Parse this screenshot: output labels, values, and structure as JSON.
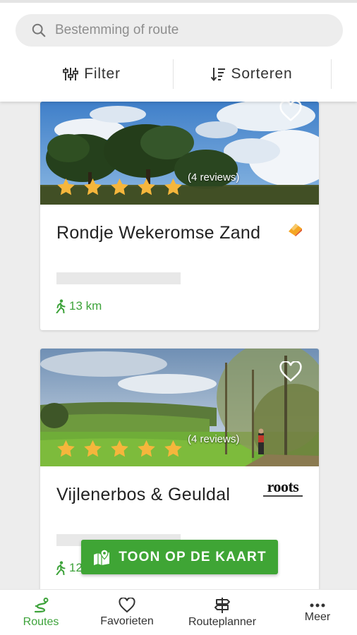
{
  "search": {
    "placeholder": "Bestemming of route"
  },
  "toolbar": {
    "filter_label": "Filter",
    "sort_label": "Sorteren"
  },
  "routes": [
    {
      "title": "Rondje Wekeromse Zand",
      "reviews": "(4 reviews)",
      "rating": 5,
      "distance": "13 km",
      "provider_logo": "orange-diamond-logo"
    },
    {
      "title": "Vijlenerbos & Geuldal",
      "reviews": "(4 reviews)",
      "rating": 5,
      "distance": "12",
      "provider_logo": "roots",
      "provider_logo_text": "roots"
    }
  ],
  "map_button": {
    "label": "TOON OP DE KAART"
  },
  "nav": [
    {
      "label": "Routes",
      "icon": "route-icon",
      "active": true
    },
    {
      "label": "Favorieten",
      "icon": "heart-icon"
    },
    {
      "label": "Routeplanner",
      "icon": "signpost-icon"
    },
    {
      "label": "Meer",
      "icon": "more-icon"
    }
  ],
  "colors": {
    "accent": "#3fa535",
    "star": "#f5b63c",
    "background": "#ededed"
  }
}
